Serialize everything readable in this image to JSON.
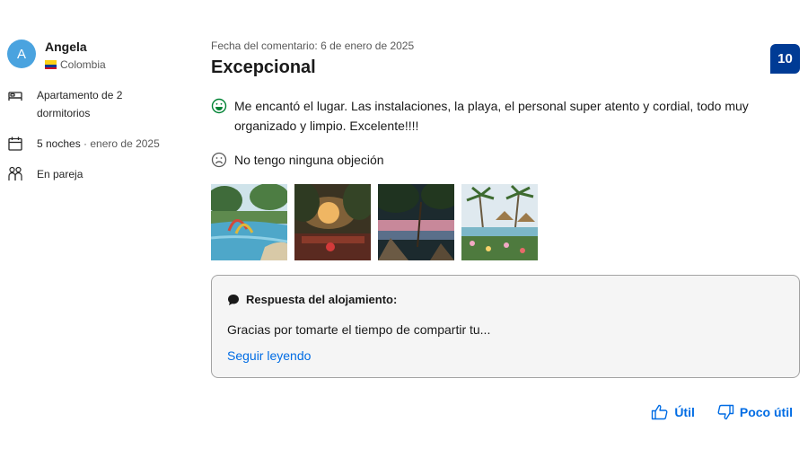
{
  "reviewer": {
    "initial": "A",
    "name": "Angela",
    "country": "Colombia"
  },
  "stay": {
    "room": "Apartamento de 2 dormitorios",
    "nights": "5 noches",
    "nights_sep": " · ",
    "month": "enero de 2025",
    "traveler": "En pareja"
  },
  "review": {
    "date": "Fecha del comentario: 6 de enero de 2025",
    "title": "Excepcional",
    "score": "10",
    "positive": "Me encantó el lugar. Las instalaciones, la playa, el personal super atento y cordial, todo muy organizado y limpio. Excelente!!!!",
    "negative": "No tengo ninguna objeción"
  },
  "response": {
    "title": "Respuesta del alojamiento:",
    "text": "Gracias por tomarte el tiempo de compartir tu...",
    "read_more": "Seguir leyendo"
  },
  "actions": {
    "helpful": "Útil",
    "not_helpful": "Poco útil"
  },
  "colors": {
    "score_bg": "#003b95",
    "link": "#006ce4",
    "avatar": "#4aa3df",
    "positive": "#008234"
  }
}
